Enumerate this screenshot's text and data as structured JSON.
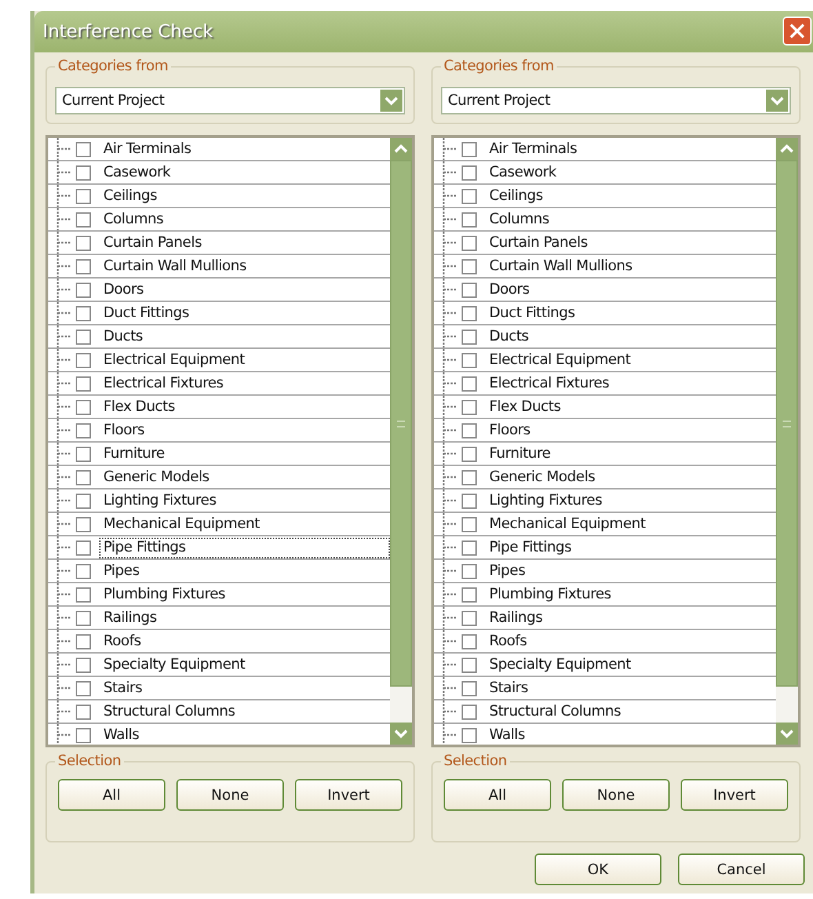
{
  "window": {
    "title": "Interference Check"
  },
  "panels": [
    {
      "categories_label": "Categories from",
      "dropdown": {
        "value": "Current Project"
      },
      "items": [
        {
          "label": "Air Terminals",
          "checked": false,
          "focused": false
        },
        {
          "label": "Casework",
          "checked": false,
          "focused": false
        },
        {
          "label": "Ceilings",
          "checked": false,
          "focused": false
        },
        {
          "label": "Columns",
          "checked": false,
          "focused": false
        },
        {
          "label": "Curtain Panels",
          "checked": false,
          "focused": false
        },
        {
          "label": "Curtain Wall Mullions",
          "checked": false,
          "focused": false
        },
        {
          "label": "Doors",
          "checked": false,
          "focused": false
        },
        {
          "label": "Duct Fittings",
          "checked": false,
          "focused": false
        },
        {
          "label": "Ducts",
          "checked": false,
          "focused": false
        },
        {
          "label": "Electrical Equipment",
          "checked": false,
          "focused": false
        },
        {
          "label": "Electrical Fixtures",
          "checked": false,
          "focused": false
        },
        {
          "label": "Flex Ducts",
          "checked": false,
          "focused": false
        },
        {
          "label": "Floors",
          "checked": false,
          "focused": false
        },
        {
          "label": "Furniture",
          "checked": false,
          "focused": false
        },
        {
          "label": "Generic Models",
          "checked": false,
          "focused": false
        },
        {
          "label": "Lighting Fixtures",
          "checked": false,
          "focused": false
        },
        {
          "label": "Mechanical Equipment",
          "checked": false,
          "focused": false
        },
        {
          "label": "Pipe Fittings",
          "checked": false,
          "focused": true
        },
        {
          "label": "Pipes",
          "checked": false,
          "focused": false
        },
        {
          "label": "Plumbing Fixtures",
          "checked": false,
          "focused": false
        },
        {
          "label": "Railings",
          "checked": false,
          "focused": false
        },
        {
          "label": "Roofs",
          "checked": false,
          "focused": false
        },
        {
          "label": "Specialty Equipment",
          "checked": false,
          "focused": false
        },
        {
          "label": "Stairs",
          "checked": false,
          "focused": false
        },
        {
          "label": "Structural Columns",
          "checked": false,
          "focused": false
        },
        {
          "label": "Walls",
          "checked": false,
          "focused": false
        }
      ],
      "selection_label": "Selection",
      "buttons": [
        "All",
        "None",
        "Invert"
      ]
    },
    {
      "categories_label": "Categories from",
      "dropdown": {
        "value": "Current Project"
      },
      "items": [
        {
          "label": "Air Terminals",
          "checked": false,
          "focused": false
        },
        {
          "label": "Casework",
          "checked": false,
          "focused": false
        },
        {
          "label": "Ceilings",
          "checked": false,
          "focused": false
        },
        {
          "label": "Columns",
          "checked": false,
          "focused": false
        },
        {
          "label": "Curtain Panels",
          "checked": false,
          "focused": false
        },
        {
          "label": "Curtain Wall Mullions",
          "checked": false,
          "focused": false
        },
        {
          "label": "Doors",
          "checked": false,
          "focused": false
        },
        {
          "label": "Duct Fittings",
          "checked": false,
          "focused": false
        },
        {
          "label": "Ducts",
          "checked": false,
          "focused": false
        },
        {
          "label": "Electrical Equipment",
          "checked": false,
          "focused": false
        },
        {
          "label": "Electrical Fixtures",
          "checked": false,
          "focused": false
        },
        {
          "label": "Flex Ducts",
          "checked": false,
          "focused": false
        },
        {
          "label": "Floors",
          "checked": false,
          "focused": false
        },
        {
          "label": "Furniture",
          "checked": false,
          "focused": false
        },
        {
          "label": "Generic Models",
          "checked": false,
          "focused": false
        },
        {
          "label": "Lighting Fixtures",
          "checked": false,
          "focused": false
        },
        {
          "label": "Mechanical Equipment",
          "checked": false,
          "focused": false
        },
        {
          "label": "Pipe Fittings",
          "checked": false,
          "focused": false
        },
        {
          "label": "Pipes",
          "checked": false,
          "focused": false
        },
        {
          "label": "Plumbing Fixtures",
          "checked": false,
          "focused": false
        },
        {
          "label": "Railings",
          "checked": false,
          "focused": false
        },
        {
          "label": "Roofs",
          "checked": false,
          "focused": false
        },
        {
          "label": "Specialty Equipment",
          "checked": false,
          "focused": false
        },
        {
          "label": "Stairs",
          "checked": false,
          "focused": false
        },
        {
          "label": "Structural Columns",
          "checked": false,
          "focused": false
        },
        {
          "label": "Walls",
          "checked": false,
          "focused": false
        }
      ],
      "selection_label": "Selection",
      "buttons": [
        "All",
        "None",
        "Invert"
      ]
    }
  ],
  "footer_buttons": [
    "OK",
    "Cancel"
  ]
}
